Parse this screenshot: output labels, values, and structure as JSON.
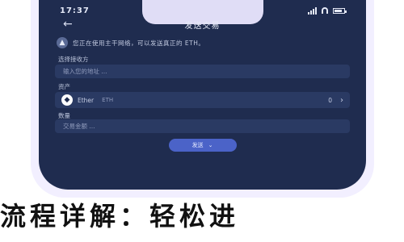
{
  "status_bar": {
    "time": "17:37"
  },
  "header": {
    "back_icon": "back-arrow-icon",
    "title": "发送交易"
  },
  "notice": {
    "icon": "warning-icon",
    "text": "您正在使用主干网络，可以发送真正的 ETH。"
  },
  "form": {
    "network_label": "选择接收方",
    "network_placeholder": "输入您的地址 ...",
    "asset_label": "资产",
    "asset": {
      "name": "Ether",
      "symbol": "ETH",
      "balance": "0"
    },
    "amount_label": "数量",
    "amount_placeholder": "交易金额 ..."
  },
  "send_button": {
    "label": "发送"
  },
  "caption": "流程详解：轻松进"
}
